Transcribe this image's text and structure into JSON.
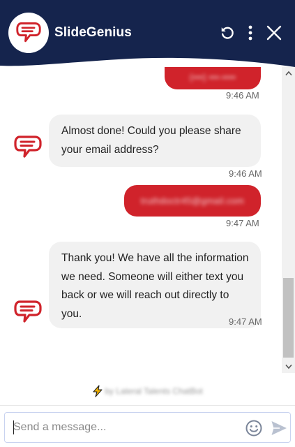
{
  "header": {
    "title": "SlideGenius",
    "colors": {
      "navy": "#15244d",
      "brand_red": "#d0232b"
    },
    "icons": [
      "refresh-icon",
      "more-vertical-icon",
      "close-icon"
    ]
  },
  "messages": [
    {
      "sender": "user",
      "text": "(•••) •••-••••",
      "time": "9:46 AM"
    },
    {
      "sender": "bot",
      "text": "Almost done! Could you please share your email address?",
      "time": "9:46 AM"
    },
    {
      "sender": "user",
      "text": "truthdoctr45@gmail.com",
      "time": "9:47 AM"
    },
    {
      "sender": "bot",
      "text": "Thank you! We have all the information we need. Someone will either text you back or we will reach out directly to you.",
      "time": "9:47 AM"
    }
  ],
  "footer": {
    "powered_by": "by Lateral Talents ChatBot"
  },
  "composer": {
    "placeholder": "Send a message..."
  }
}
